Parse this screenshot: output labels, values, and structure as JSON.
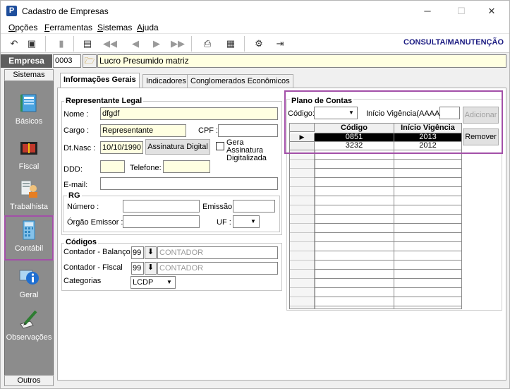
{
  "window": {
    "title": "Cadastro de Empresas",
    "minimize": "─",
    "maximize": "☐",
    "close": "✕"
  },
  "menu": [
    "Opções",
    "Ferramentas",
    "Sistemas",
    "Ajuda"
  ],
  "toolbar": {
    "mode_label": "CONSULTA/MANUTENÇÃO"
  },
  "empresa": {
    "label": "Empresa",
    "code": "0003",
    "name": "Lucro Presumido matriz"
  },
  "sidebar": {
    "header": "Sistemas",
    "footer": "Outros",
    "items": [
      {
        "label": "Básicos",
        "icon": "notebook-icon"
      },
      {
        "label": "Fiscal",
        "icon": "ledger-icon"
      },
      {
        "label": "Trabalhista",
        "icon": "worker-icon"
      },
      {
        "label": "Contábil",
        "icon": "calculator-icon"
      },
      {
        "label": "Geral",
        "icon": "info-icon"
      },
      {
        "label": "Observações",
        "icon": "pen-icon"
      }
    ]
  },
  "tabs": [
    "Informações Gerais",
    "Indicadores",
    "Conglomerados Econômicos"
  ],
  "representante": {
    "title": "Representante Legal",
    "nome_label": "Nome :",
    "nome": "dfgdf",
    "cargo_label": "Cargo :",
    "cargo": "Representante",
    "cpf_label": "CPF :",
    "cpf": "",
    "dtnasc_label": "Dt.Nasc :",
    "dtnasc": "10/10/1990",
    "assinatura_btn": "Assinatura Digital",
    "gera_assinatura": "Gera Assinatura Digitalizada",
    "ddd_label": "DDD:",
    "ddd": "",
    "telefone_label": "Telefone:",
    "telefone": "",
    "email_label": "E-mail:",
    "email": ""
  },
  "rg": {
    "title": "RG",
    "numero_label": "Número :",
    "numero": "",
    "emissao_label": "Emissão :",
    "emissao": "",
    "orgao_label": "Órgão Emissor :",
    "orgao": "",
    "uf_label": "UF :",
    "uf": ""
  },
  "codigos": {
    "title": "Códigos",
    "balanco_label": "Contador - Balanço",
    "balanco_code": "99",
    "balanco_placeholder": "CONTADOR",
    "fiscal_label": "Contador - Fiscal",
    "fiscal_code": "99",
    "fiscal_placeholder": "CONTADOR",
    "categorias_label": "Categorias",
    "categorias_value": "LCDP"
  },
  "plano": {
    "title": "Plano de Contas",
    "codigo_label": "Código:",
    "codigo": "",
    "vigencia_label": "Início Vigência(AAAA):",
    "vigencia": "",
    "adicionar": "Adicionar",
    "remover": "Remover",
    "columns": [
      "Código",
      "Início Vigência"
    ],
    "rows": [
      {
        "codigo": "0851",
        "vigencia": "2013",
        "selected": true
      },
      {
        "codigo": "3232",
        "vigencia": "2012",
        "selected": false
      }
    ]
  }
}
